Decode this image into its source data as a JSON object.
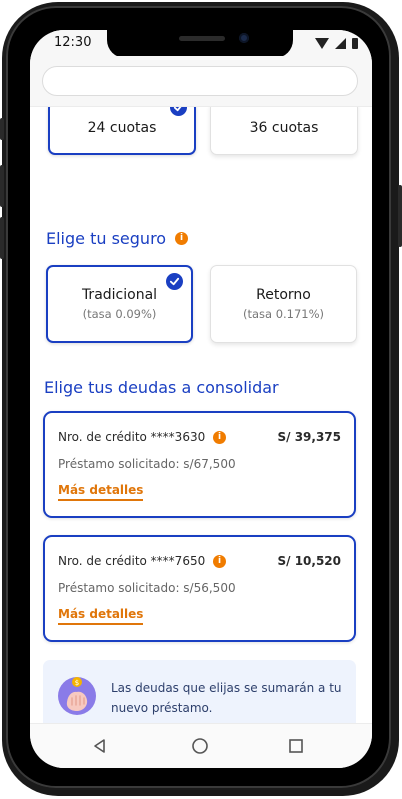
{
  "status_bar": {
    "time": "12:30"
  },
  "browser": {
    "url": ""
  },
  "installments": {
    "options": [
      {
        "label": "24 cuotas",
        "selected": true
      },
      {
        "label": "36 cuotas",
        "selected": false
      }
    ]
  },
  "insurance": {
    "title": "Elige tu seguro",
    "options": [
      {
        "label": "Tradicional",
        "rate": "(tasa 0.09%)",
        "selected": true
      },
      {
        "label": "Retorno",
        "rate": "(tasa 0.171%)",
        "selected": false
      }
    ]
  },
  "debts": {
    "title": "Elige tus deudas a consolidar",
    "items": [
      {
        "credit": "Nro. de crédito ****3630",
        "amount": "S/ 39,375",
        "requested": "Préstamo solicitado: s/67,500",
        "details_link": "Más detalles"
      },
      {
        "credit": "Nro. de crédito ****7650",
        "amount": "S/ 10,520",
        "requested": "Préstamo solicitado: s/56,500",
        "details_link": "Más detalles"
      }
    ]
  },
  "notice": {
    "text": "Las deudas que elijas se sumarán a tu nuevo préstamo."
  },
  "colors": {
    "primary": "#1a3fc2",
    "accent": "#f07c00",
    "notice_bg": "#eef3fd"
  },
  "icons": {
    "check": "check-icon",
    "info": "info-icon",
    "notice": "hand-coin-icon",
    "nav_back": "triangle-back-icon",
    "nav_home": "circle-home-icon",
    "nav_recent": "square-recent-icon"
  }
}
